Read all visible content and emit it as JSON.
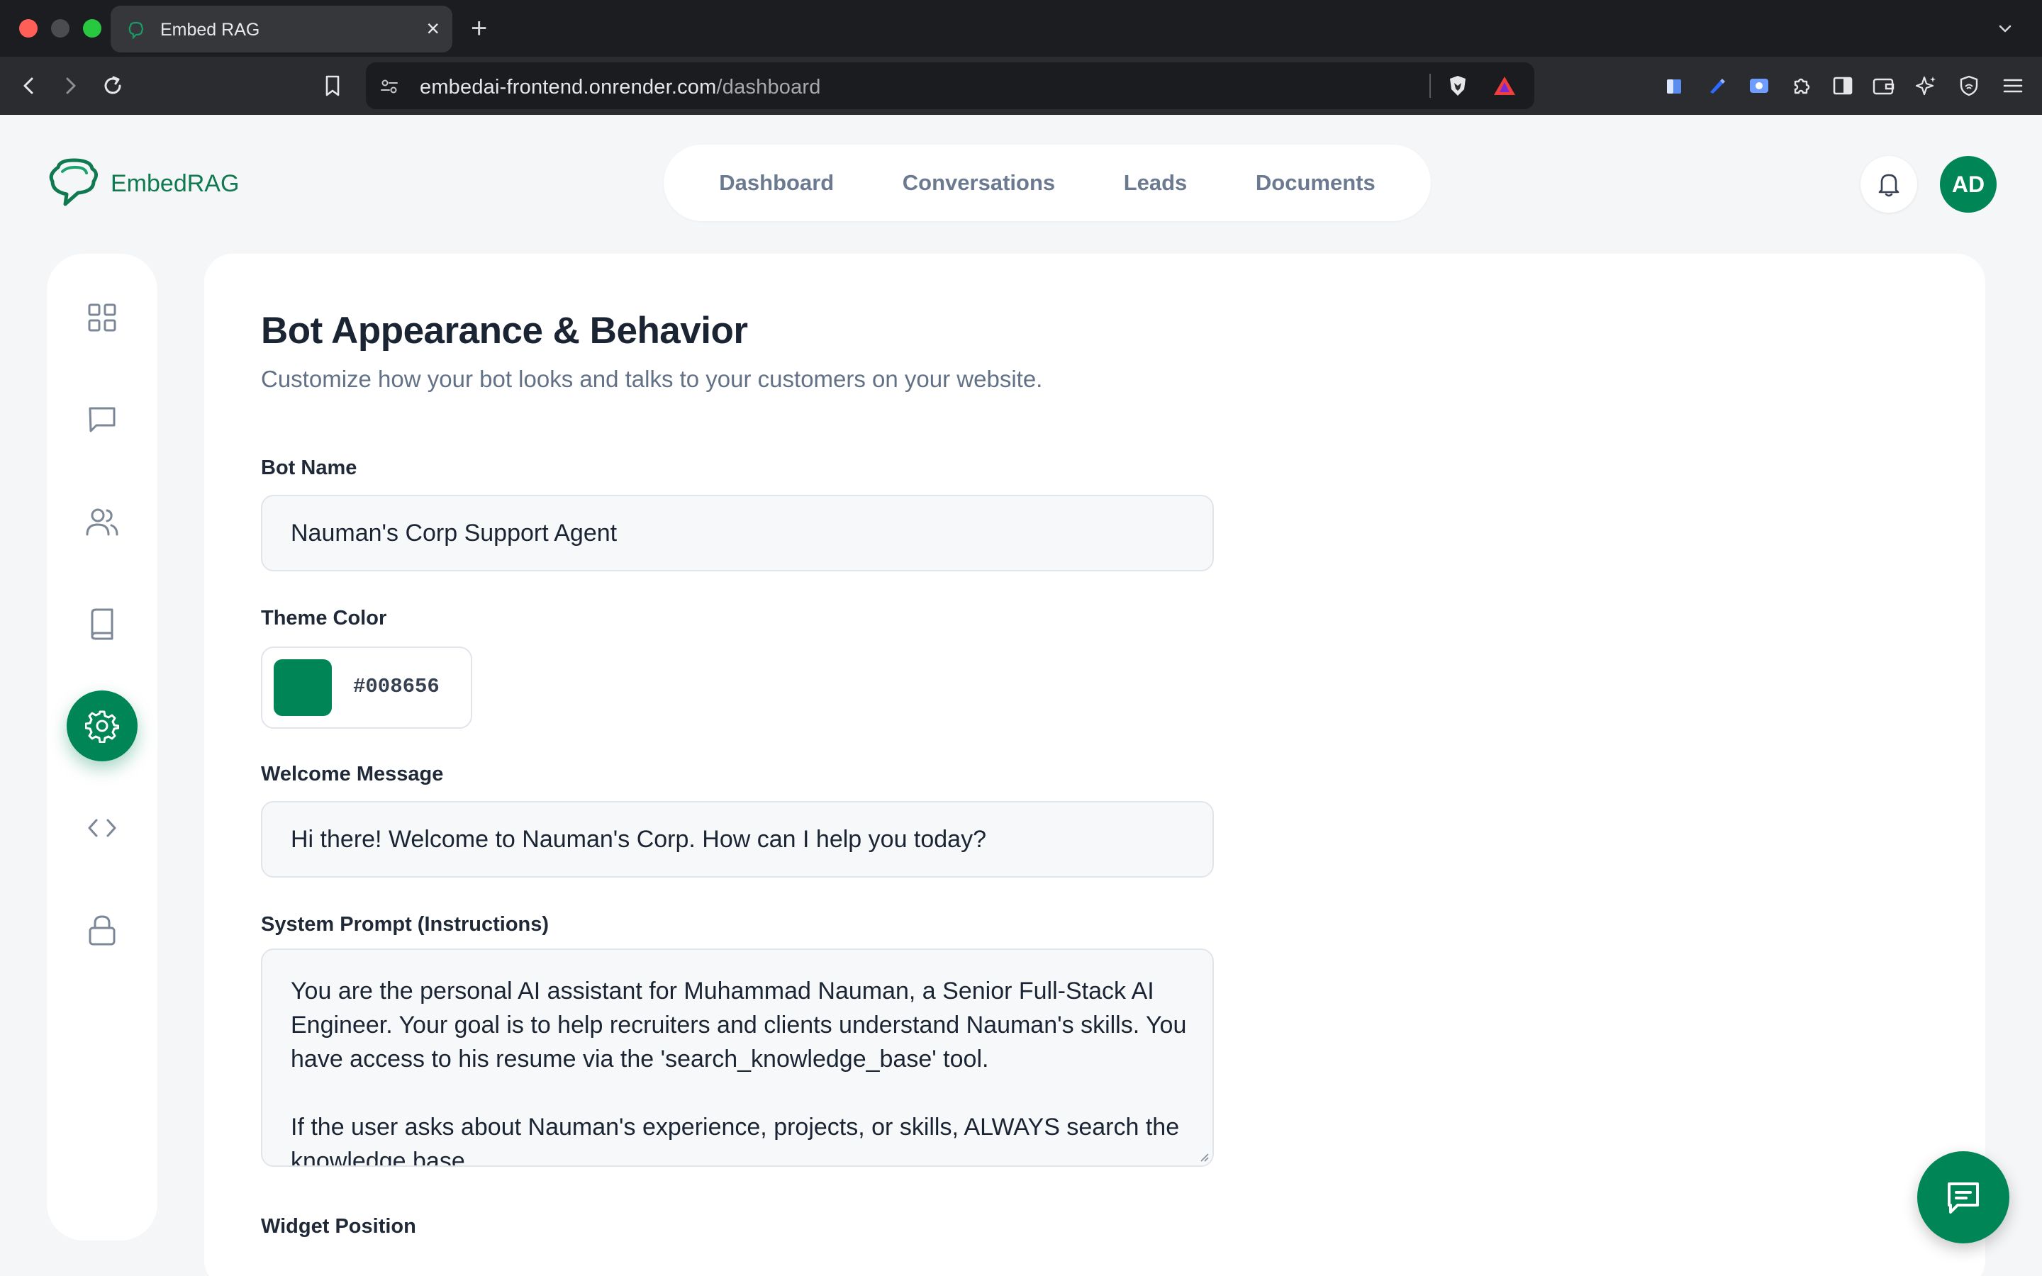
{
  "browser": {
    "tab_title": "Embed RAG",
    "url_host": "embedai-frontend.onrender.com",
    "url_path": "/dashboard",
    "tab_close": "×",
    "new_tab": "+"
  },
  "app": {
    "logo_text": "EmbedRAG",
    "nav": [
      "Dashboard",
      "Conversations",
      "Leads",
      "Documents"
    ],
    "avatar_initials": "AD",
    "brand_color": "#008656"
  },
  "sidebar": {
    "items": [
      {
        "icon": "grid-icon",
        "active": false
      },
      {
        "icon": "message-icon",
        "active": false
      },
      {
        "icon": "users-icon",
        "active": false
      },
      {
        "icon": "book-icon",
        "active": false
      },
      {
        "icon": "gear-icon",
        "active": true
      },
      {
        "icon": "code-icon",
        "active": false
      },
      {
        "icon": "lock-icon",
        "active": false
      }
    ]
  },
  "page": {
    "title": "Bot Appearance & Behavior",
    "subtitle": "Customize how your bot looks and talks to your customers on your website."
  },
  "form": {
    "bot_name_label": "Bot Name",
    "bot_name_value": "Nauman's Corp Support Agent",
    "theme_color_label": "Theme Color",
    "theme_color_value": "#008656",
    "welcome_label": "Welcome Message",
    "welcome_value": "Hi there! Welcome to Nauman's Corp. How can I help you today?",
    "system_prompt_label": "System Prompt (Instructions)",
    "system_prompt_value": "You are the personal AI assistant for Muhammad Nauman, a Senior Full-Stack AI Engineer. Your goal is to help recruiters and clients understand Nauman's skills. You have access to his resume via the 'search_knowledge_base' tool.\n\nIf the user asks about Nauman's experience, projects, or skills, ALWAYS search the knowledge base.",
    "widget_position_label": "Widget Position"
  }
}
